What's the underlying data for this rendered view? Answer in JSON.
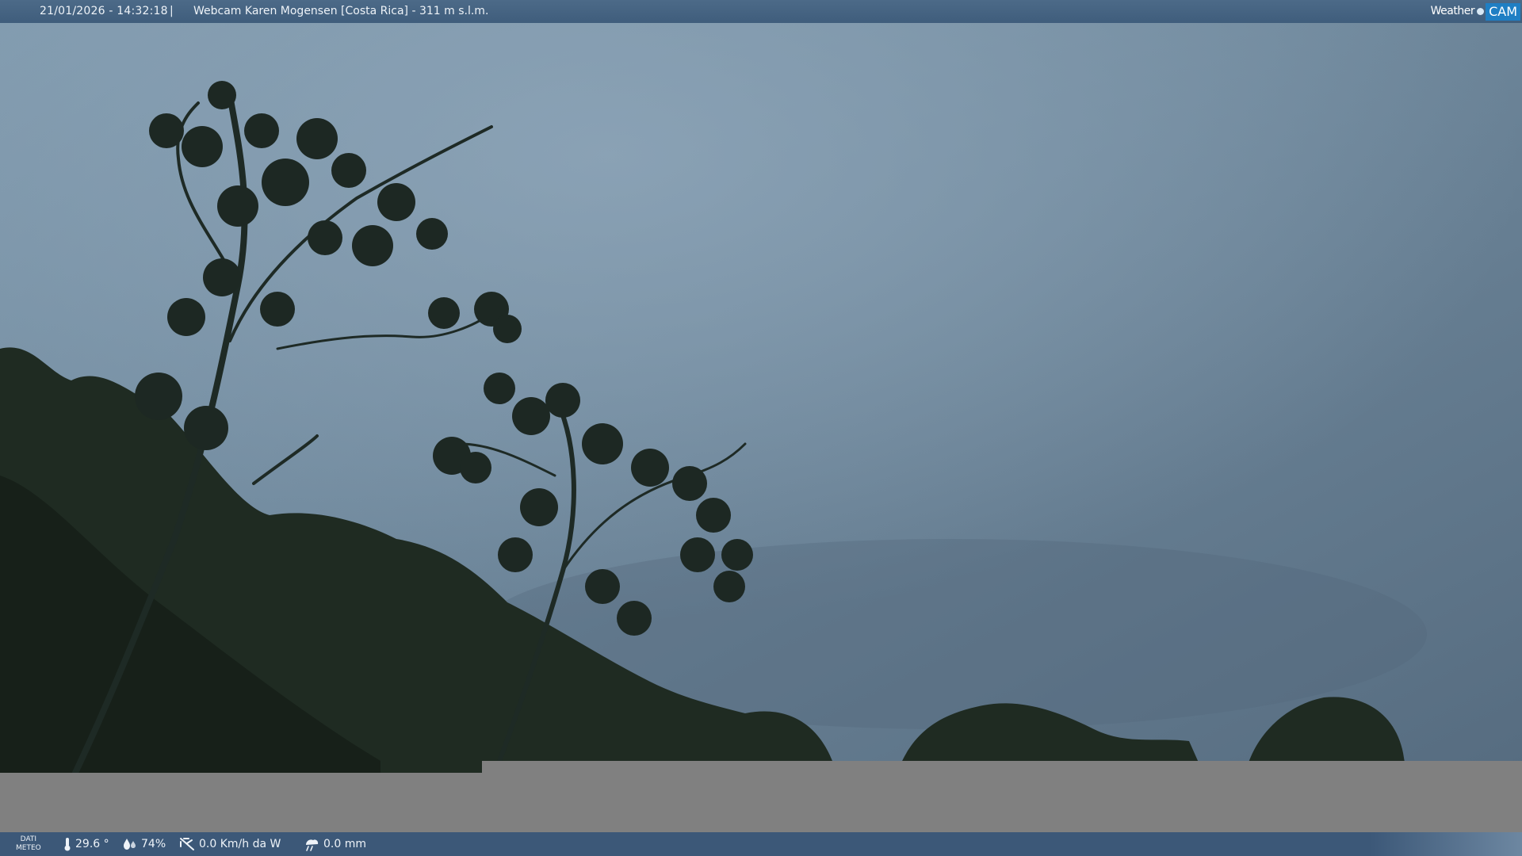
{
  "header": {
    "datetime": "21/01/2026 - 14:32:18",
    "separator": "|",
    "camera_title": "Webcam Karen Mogensen [Costa Rica]  - 311 m s.l.m."
  },
  "logo": {
    "weather_text": "Weather",
    "cam_text": "CAM"
  },
  "footer": {
    "label_line1": "DATI",
    "label_line2": "METEO",
    "temperature": "29.6 °",
    "humidity": "74%",
    "wind": "0.0 Km/h da W",
    "rain": "0.0 mm"
  },
  "icons": {
    "temperature": "thermometer-icon",
    "humidity": "humidity-icon",
    "wind": "wind-icon",
    "rain": "rain-icon"
  },
  "colors": {
    "bar": "#3f5d7c",
    "logo_accent": "#1f7fc4",
    "gray_band": "#808080"
  }
}
